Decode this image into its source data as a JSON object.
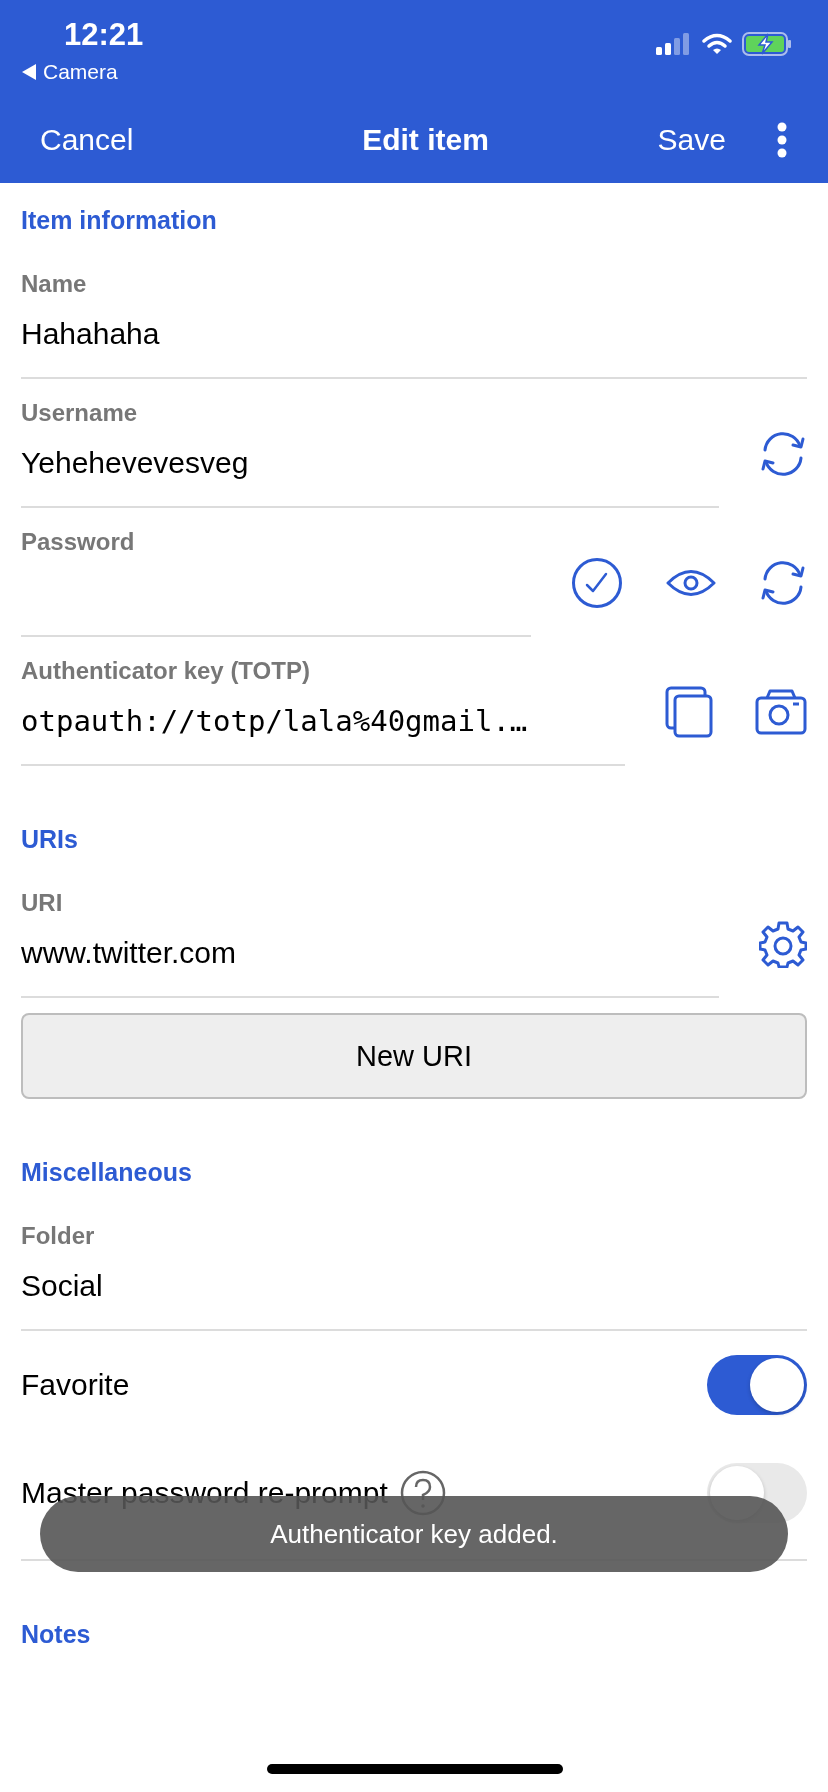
{
  "status_bar": {
    "time": "12:21",
    "back_app": "Camera"
  },
  "nav": {
    "cancel": "Cancel",
    "title": "Edit item",
    "save": "Save"
  },
  "sections": [
    {
      "title": "Item information",
      "rows": [
        {
          "kind": "field",
          "label": "Name",
          "value": "Hahahaha"
        },
        {
          "kind": "field",
          "label": "Username",
          "value": "Yehehevevesveg",
          "actions": [
            {
              "kind": "generate"
            }
          ]
        },
        {
          "kind": "field",
          "label": "Password",
          "actions": [
            {
              "kind": "check"
            },
            {
              "kind": "show"
            },
            {
              "kind": "generate"
            }
          ]
        },
        {
          "kind": "code_field",
          "label": "Authenticator key (TOTP)",
          "value": "otpauth://totp/lala%40gmail.…",
          "actions": [
            {
              "kind": "copy"
            },
            {
              "kind": "camera"
            }
          ]
        }
      ]
    },
    {
      "title": "URIs",
      "rows": [
        {
          "kind": "field",
          "label": "URI",
          "value": "www.twitter.com",
          "actions": [
            {
              "kind": "settings"
            }
          ]
        },
        {
          "kind": "button",
          "label": "New URI"
        }
      ]
    },
    {
      "title": "Miscellaneous",
      "rows": [
        {
          "kind": "field",
          "label": "Folder",
          "value": "Social"
        },
        {
          "kind": "switch",
          "label": "Favorite",
          "on": true
        },
        {
          "kind": "switch",
          "label": "Master password re-prompt",
          "on": false,
          "help": true
        }
      ]
    },
    {
      "title": "Notes"
    }
  ],
  "toast": {
    "message": "Authenticator key added."
  }
}
